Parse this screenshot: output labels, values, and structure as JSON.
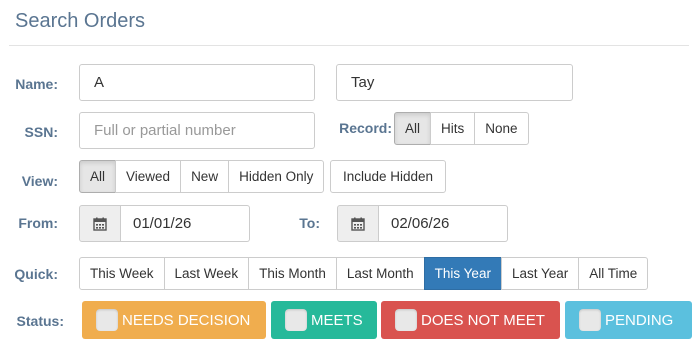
{
  "header": {
    "title": "Search Orders"
  },
  "form": {
    "name_label": "Name:",
    "first_name_value": "A",
    "last_name_value": "Tay",
    "ssn_label": "SSN:",
    "ssn_placeholder": "Full or partial number",
    "record_label": "Record:",
    "record_options": [
      "All",
      "Hits",
      "None"
    ],
    "record_selected": "All",
    "view_label": "View:",
    "view_options": [
      "All",
      "Viewed",
      "New",
      "Hidden Only"
    ],
    "view_selected": "All",
    "include_hidden_label": "Include Hidden",
    "from_label": "From:",
    "from_value": "01/01/26",
    "to_label": "To:",
    "to_value": "02/06/26",
    "quick_label": "Quick:",
    "quick_options": [
      "This Week",
      "Last Week",
      "This Month",
      "Last Month",
      "This Year",
      "Last Year",
      "All Time"
    ],
    "quick_selected": "This Year",
    "status_label": "Status:",
    "status_options": [
      {
        "label": "NEEDS DECISION",
        "color": "#f0ad4e"
      },
      {
        "label": "MEETS",
        "color": "#26b99a"
      },
      {
        "label": "DOES NOT MEET",
        "color": "#d9534f"
      },
      {
        "label": "PENDING",
        "color": "#5bc0de"
      }
    ]
  },
  "icons": {
    "calendar": "calendar-icon"
  }
}
